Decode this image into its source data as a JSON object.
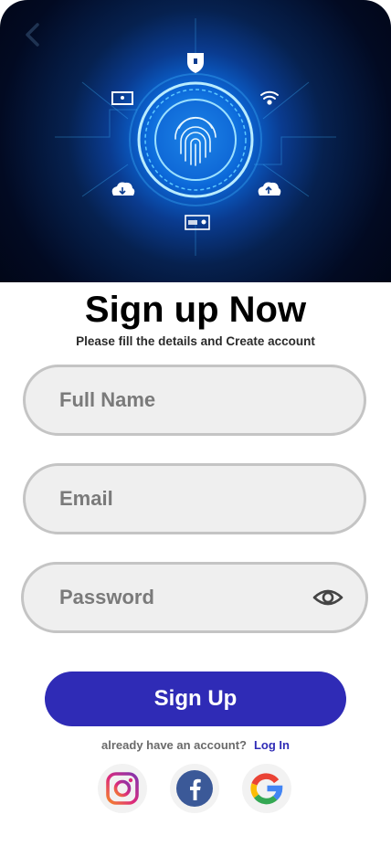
{
  "screen": {
    "title": "Sign up Now",
    "subtitle": "Please fill the details and Create account"
  },
  "hero": {
    "icons": [
      "back-chevron-icon",
      "fingerprint-icon",
      "shield-icon",
      "wifi-icon",
      "monitor-icon",
      "cloud-download-icon",
      "cloud-upload-icon",
      "card-icon"
    ]
  },
  "form": {
    "full_name_placeholder": "Full Name",
    "email_placeholder": "Email",
    "password_placeholder": "Password",
    "password_icon": "eye-icon",
    "submit_label": "Sign Up"
  },
  "footer": {
    "prompt": "already have an account?",
    "login_label": "Log In"
  },
  "social": {
    "providers": [
      "instagram",
      "facebook",
      "google"
    ]
  },
  "colors": {
    "accent": "#2f2bb6",
    "field_bg": "#efefef",
    "field_border": "#c4c4c4",
    "hero_dark": "#020a22",
    "hero_glow": "#2aa7ff"
  }
}
